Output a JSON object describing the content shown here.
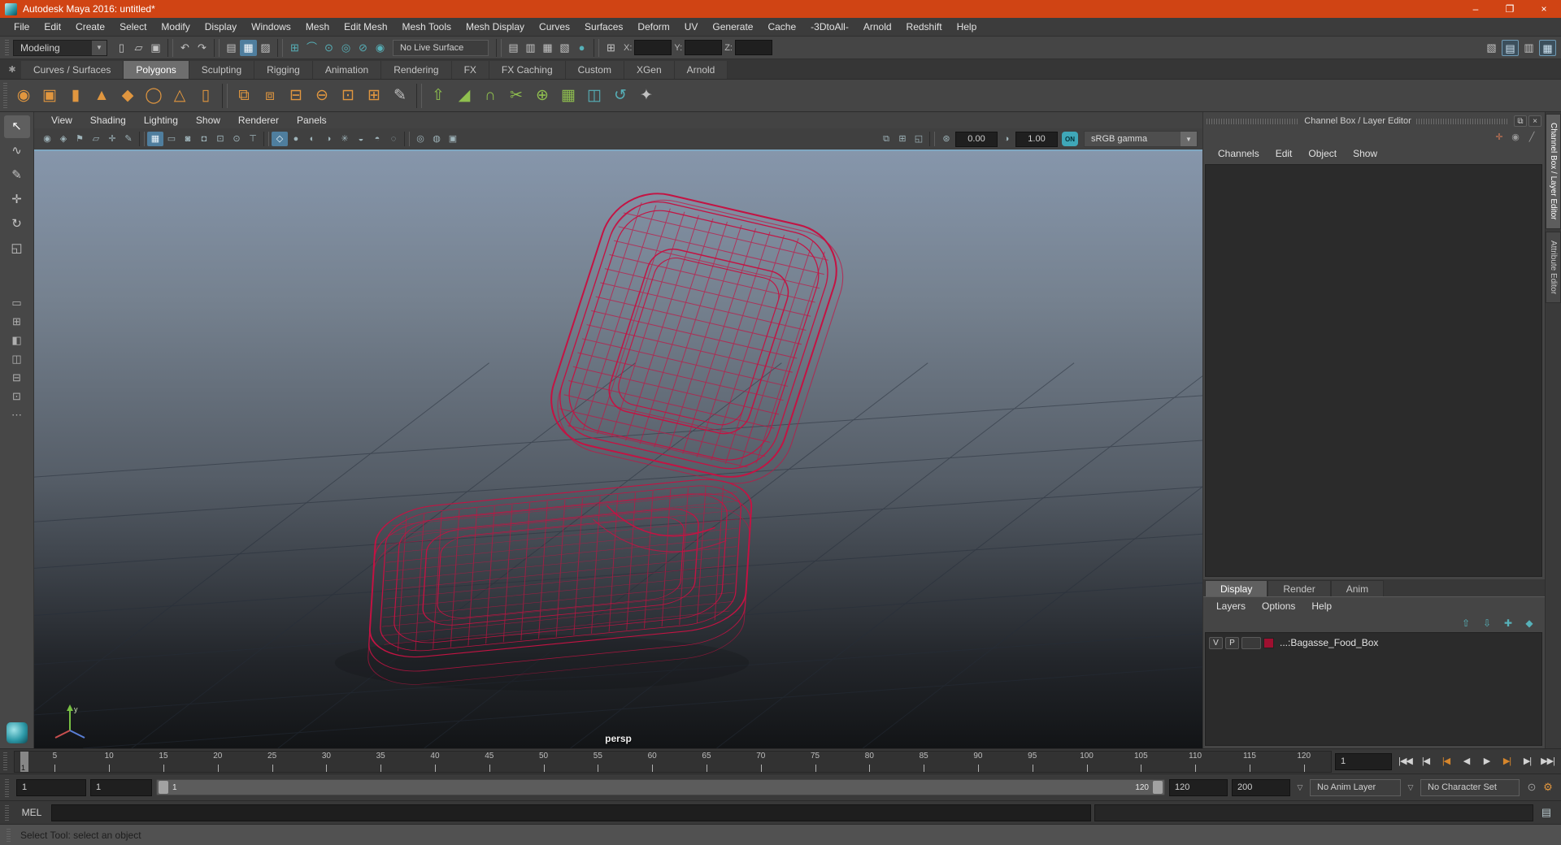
{
  "colors": {
    "titlebar": "#d04414",
    "wireframe": "#c41343",
    "accent_blue": "#4f7e9e",
    "teal": "#51a8b0"
  },
  "window": {
    "title": "Autodesk Maya 2016: untitled*",
    "controls": [
      {
        "name": "minimize",
        "glyph": "–"
      },
      {
        "name": "maximize",
        "glyph": "❐"
      },
      {
        "name": "close",
        "glyph": "×"
      }
    ]
  },
  "menu_bar": {
    "items": [
      "File",
      "Edit",
      "Create",
      "Select",
      "Modify",
      "Display",
      "Windows",
      "Mesh",
      "Edit Mesh",
      "Mesh Tools",
      "Mesh Display",
      "Curves",
      "Surfaces",
      "Deform",
      "UV",
      "Generate",
      "Cache",
      "-3DtoAll-",
      "Arnold",
      "Redshift",
      "Help"
    ]
  },
  "statusline": {
    "menuset": "Modeling",
    "dropdown_arrow": "▼",
    "icons_left": [
      {
        "name": "new-scene",
        "glyph": "▯"
      },
      {
        "name": "open-scene",
        "glyph": "▱"
      },
      {
        "name": "save-scene",
        "glyph": "▣"
      },
      {
        "cls": "sep"
      },
      {
        "name": "undo",
        "glyph": "↶"
      },
      {
        "name": "redo",
        "glyph": "↷"
      },
      {
        "cls": "sep"
      },
      {
        "name": "select-by-hierarchy",
        "glyph": "▤"
      },
      {
        "name": "select-by-object",
        "glyph": "▦",
        "cls": "hl"
      },
      {
        "name": "select-by-component",
        "glyph": "▨"
      },
      {
        "cls": "sep"
      },
      {
        "name": "snap-to-grid",
        "glyph": "⊞",
        "cls": "teal"
      },
      {
        "name": "snap-to-curve",
        "glyph": "⌒",
        "cls": "teal"
      },
      {
        "name": "snap-to-point",
        "glyph": "⊙",
        "cls": "teal"
      },
      {
        "name": "snap-to-projected-center",
        "glyph": "◎",
        "cls": "teal"
      },
      {
        "name": "snap-to-view-plane",
        "glyph": "⊘",
        "cls": "teal"
      },
      {
        "name": "make-live",
        "glyph": "◉",
        "cls": "teal"
      }
    ],
    "live_surface": "No Live Surface",
    "icons_render": [
      {
        "cls": "sep"
      },
      {
        "name": "render-view",
        "glyph": "▤"
      },
      {
        "name": "quick-render",
        "glyph": "▥"
      },
      {
        "name": "ipr-render",
        "glyph": "▦"
      },
      {
        "name": "render-settings",
        "glyph": "▧"
      },
      {
        "name": "launch-render",
        "glyph": "●",
        "cls": "teal"
      },
      {
        "cls": "sep"
      },
      {
        "name": "object-details",
        "glyph": "⊞"
      }
    ],
    "coord_labels": {
      "x": "X:",
      "y": "Y:",
      "z": "Z:"
    },
    "icons_right": [
      {
        "name": "modeling-toolkit-toggle",
        "glyph": "▧"
      },
      {
        "name": "channel-box-toggle",
        "glyph": "▤",
        "cls": "hl2"
      },
      {
        "name": "attribute-editor-toggle",
        "glyph": "▥"
      },
      {
        "name": "tool-settings-toggle",
        "glyph": "▦",
        "cls": "hl2"
      }
    ]
  },
  "shelf": {
    "gear_glyph": "✱",
    "tabs": [
      "Curves / Surfaces",
      "Polygons",
      "Sculpting",
      "Rigging",
      "Animation",
      "Rendering",
      "FX",
      "FX Caching",
      "Custom",
      "XGen",
      "Arnold"
    ],
    "active_tab": "Polygons",
    "icons": [
      {
        "name": "poly-sphere",
        "glyph": "◉",
        "cls": "orange"
      },
      {
        "name": "poly-cube",
        "glyph": "▣",
        "cls": "orange"
      },
      {
        "name": "poly-cylinder",
        "glyph": "▮",
        "cls": "orange"
      },
      {
        "name": "poly-cone",
        "glyph": "▲",
        "cls": "orange"
      },
      {
        "name": "poly-plane",
        "glyph": "◆",
        "cls": "orange"
      },
      {
        "name": "poly-torus",
        "glyph": "◯",
        "cls": "orange"
      },
      {
        "name": "poly-pyramid",
        "glyph": "△",
        "cls": "orange"
      },
      {
        "name": "poly-pipe",
        "glyph": "▯",
        "cls": "orange"
      },
      {
        "cls": "sep"
      },
      {
        "name": "combine",
        "glyph": "⧉",
        "cls": "orange"
      },
      {
        "name": "separate",
        "glyph": "⧈",
        "cls": "orange"
      },
      {
        "name": "extract",
        "glyph": "⊟",
        "cls": "orange"
      },
      {
        "name": "booleans",
        "glyph": "⊖",
        "cls": "orange"
      },
      {
        "name": "smooth",
        "glyph": "⊡",
        "cls": "orange"
      },
      {
        "name": "subdivide",
        "glyph": "⊞",
        "cls": "orange"
      },
      {
        "name": "crease-tool",
        "glyph": "✎",
        "cls": "gray"
      },
      {
        "cls": "sep"
      },
      {
        "name": "extrude",
        "glyph": "⇧",
        "cls": "green"
      },
      {
        "name": "bevel",
        "glyph": "◢",
        "cls": "green"
      },
      {
        "name": "bridge",
        "glyph": "∩",
        "cls": "green"
      },
      {
        "name": "multi-cut",
        "glyph": "✂",
        "cls": "green"
      },
      {
        "name": "target-weld",
        "glyph": "⊕",
        "cls": "green"
      },
      {
        "name": "quad-draw",
        "glyph": "▦",
        "cls": "green"
      },
      {
        "name": "mirror",
        "glyph": "◫",
        "cls": "teal"
      },
      {
        "name": "symmetry",
        "glyph": "↺",
        "cls": "teal"
      },
      {
        "name": "sculpt-shelf",
        "glyph": "✦",
        "cls": "gray"
      }
    ]
  },
  "toolbox": {
    "tools": [
      {
        "name": "select-tool",
        "glyph": "↖",
        "cls": "active"
      },
      {
        "name": "lasso-tool",
        "glyph": "∿"
      },
      {
        "name": "paint-selection-tool",
        "glyph": "✎"
      },
      {
        "name": "move-tool",
        "glyph": "✛"
      },
      {
        "name": "rotate-tool",
        "glyph": "↻"
      },
      {
        "name": "scale-tool",
        "glyph": "◱"
      }
    ],
    "layouts": [
      {
        "name": "single-pane-layout",
        "glyph": "▭"
      },
      {
        "name": "four-pane-layout",
        "glyph": "⊞"
      },
      {
        "name": "persp-outliner-layout",
        "glyph": "◧"
      },
      {
        "name": "two-pane-side-layout",
        "glyph": "◫"
      },
      {
        "name": "two-pane-stacked-layout",
        "glyph": "⊟"
      },
      {
        "name": "persp-graph-layout",
        "glyph": "⊡"
      },
      {
        "name": "more-layouts",
        "glyph": "⋯"
      }
    ]
  },
  "viewport": {
    "panel_menus": [
      "View",
      "Shading",
      "Lighting",
      "Show",
      "Renderer",
      "Panels"
    ],
    "toolbar_icons": [
      {
        "name": "select-camera",
        "glyph": "◉"
      },
      {
        "name": "lock-camera",
        "glyph": "◈"
      },
      {
        "name": "camera-bookmark",
        "glyph": "⚑"
      },
      {
        "name": "image-plane",
        "glyph": "▱"
      },
      {
        "name": "2d-pan-zoom",
        "glyph": "✛"
      },
      {
        "name": "grease-pencil",
        "glyph": "✎"
      },
      {
        "cls": "sep"
      },
      {
        "name": "grid-toggle",
        "glyph": "▦",
        "cls": "active"
      },
      {
        "name": "film-gate",
        "glyph": "▭"
      },
      {
        "name": "resolution-gate",
        "glyph": "◙"
      },
      {
        "name": "gate-mask",
        "glyph": "◘"
      },
      {
        "name": "field-chart",
        "glyph": "⊡"
      },
      {
        "name": "safe-action",
        "glyph": "⊙"
      },
      {
        "name": "safe-title",
        "glyph": "⊤"
      },
      {
        "cls": "sep"
      },
      {
        "name": "wireframe-display",
        "glyph": "◇",
        "cls": "active"
      },
      {
        "name": "smooth-shade",
        "glyph": "●"
      },
      {
        "name": "wireframe-on-shaded",
        "glyph": "◐"
      },
      {
        "name": "textured",
        "glyph": "◑"
      },
      {
        "name": "use-all-lights",
        "glyph": "✳"
      },
      {
        "name": "shadows",
        "glyph": "◒"
      },
      {
        "name": "screen-space-ao",
        "glyph": "◓"
      },
      {
        "name": "motion-blur",
        "glyph": "◌"
      },
      {
        "cls": "sep"
      },
      {
        "name": "isolate-select",
        "glyph": "◎"
      },
      {
        "name": "xray",
        "glyph": "◍"
      },
      {
        "name": "plugin-display",
        "glyph": "▣"
      }
    ],
    "toolbar_right_icons": [
      {
        "name": "tear-off-copy",
        "glyph": "⧉"
      },
      {
        "name": "tear-off",
        "glyph": "⊞"
      },
      {
        "name": "pane-split",
        "glyph": "◱"
      },
      {
        "cls": "sep"
      }
    ],
    "exposure_glyph": "⊛",
    "exposure": "0.00",
    "contrast_glyph": "◑",
    "gamma": "1.00",
    "gamma_on": "ON",
    "view_transform": "sRGB gamma",
    "view_transform_arrow": "▼",
    "camera_label": "persp"
  },
  "channel_box": {
    "title": "Channel Box / Layer Editor",
    "window_icons": [
      {
        "name": "float-panel",
        "glyph": "⧉"
      },
      {
        "name": "close-panel",
        "glyph": "×"
      }
    ],
    "corner_icons": [
      {
        "name": "axis-orientation",
        "glyph": "✛",
        "cls": "axis"
      },
      {
        "name": "manipulator-mode",
        "glyph": "◉",
        "cls": "dim"
      },
      {
        "name": "speed-control",
        "glyph": "╱",
        "cls": "dim"
      }
    ],
    "menus": [
      "Channels",
      "Edit",
      "Object",
      "Show"
    ],
    "side_tabs": [
      "Channel Box / Layer Editor",
      "Attribute Editor"
    ],
    "active_side_tab": "Channel Box / Layer Editor"
  },
  "layer_editor": {
    "tabs": [
      "Display",
      "Render",
      "Anim"
    ],
    "active_tab": "Display",
    "menus": [
      "Layers",
      "Options",
      "Help"
    ],
    "icons": [
      {
        "name": "move-layer-up",
        "glyph": "⇧",
        "cls": "teal"
      },
      {
        "name": "move-layer-down",
        "glyph": "⇩",
        "cls": "teal"
      },
      {
        "name": "create-empty-layer",
        "glyph": "✚",
        "cls": "teal"
      },
      {
        "name": "create-layer-from-selected",
        "glyph": "◆",
        "cls": "teal"
      }
    ],
    "layers": [
      {
        "visible": "V",
        "playback": "P",
        "extra": "",
        "color": "#9e1030",
        "name": "...:Bagasse_Food_Box"
      }
    ]
  },
  "time_slider": {
    "ticks": [
      "5",
      "10",
      "15",
      "20",
      "25",
      "30",
      "35",
      "40",
      "45",
      "50",
      "55",
      "60",
      "65",
      "70",
      "75",
      "80",
      "85",
      "90",
      "95",
      "100",
      "105",
      "110",
      "115",
      "120"
    ],
    "marker": "1",
    "current_frame": "1",
    "playback": [
      {
        "name": "go-to-start",
        "glyph": "|◀◀"
      },
      {
        "name": "step-back-frame",
        "glyph": "|◀"
      },
      {
        "name": "step-back-key",
        "glyph": "|◀",
        "cls": "key"
      },
      {
        "name": "play-backward",
        "glyph": "◀"
      },
      {
        "name": "play-forward",
        "glyph": "▶"
      },
      {
        "name": "step-forward-key",
        "glyph": "▶|",
        "cls": "key"
      },
      {
        "name": "step-forward-frame",
        "glyph": "▶|"
      },
      {
        "name": "go-to-end",
        "glyph": "▶▶|"
      }
    ]
  },
  "range_slider": {
    "anim_start": "1",
    "playback_start": "1",
    "range_start_label": "1",
    "range_end_label": "120",
    "playback_end": "120",
    "anim_end": "200",
    "dropdown_arrow": "▽",
    "anim_layer": "No Anim Layer",
    "character_set": "No Character Set",
    "icons": [
      {
        "name": "auto-keyframe",
        "glyph": "⊙",
        "cls": "dim"
      },
      {
        "name": "animation-preferences",
        "glyph": "⚙",
        "cls": "orange"
      }
    ]
  },
  "command_line": {
    "label": "MEL",
    "script_editor_glyph": "▤"
  },
  "help_line": {
    "text": "Select Tool: select an object"
  }
}
